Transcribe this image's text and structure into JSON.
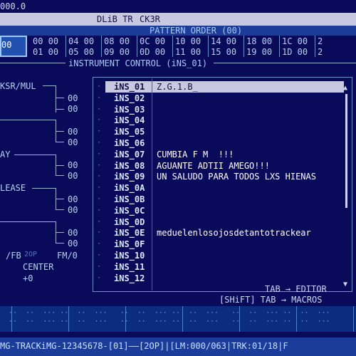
{
  "topbar": {
    "left_value": "000.0",
    "title": "DLiB TR",
    "mid": "CK3R"
  },
  "pattern_order": {
    "title": "PATTERN ORDER (00)",
    "current": "00",
    "row1": [
      "00",
      "04",
      "08",
      "0C",
      "10",
      "14",
      "18",
      "1C",
      "2"
    ],
    "row1b": [
      "00",
      "00",
      "00",
      "00",
      "00",
      "00",
      "00",
      "00"
    ],
    "row2": [
      "01",
      "05",
      "09",
      "0D",
      "11",
      "15",
      "19",
      "1D",
      "2"
    ],
    "row2b": [
      "00",
      "00",
      "00",
      "00",
      "00",
      "00",
      "00",
      "00"
    ]
  },
  "instrument_control": {
    "title": "iNSTRUMENT CONTROL (iNS_01)",
    "left": {
      "ksr_mul": "KSR/MUL",
      "v1": "00",
      "v2": "00",
      "v3": "00",
      "v4": "00",
      "v5": "00",
      "v6": "00",
      "v7": "00",
      "v8": "00",
      "ay": "AY",
      "lease": "LEASE",
      "fb": "/FB",
      "fb2": "2OP",
      "fm": "FM/0",
      "center": "CENTER",
      "plus0": "+0"
    },
    "instruments": [
      {
        "label": "iNS_01",
        "name": "Z.G.1.B_"
      },
      {
        "label": "iNS_02",
        "name": ""
      },
      {
        "label": "iNS_03",
        "name": ""
      },
      {
        "label": "iNS_04",
        "name": ""
      },
      {
        "label": "iNS_05",
        "name": ""
      },
      {
        "label": "iNS_06",
        "name": ""
      },
      {
        "label": "iNS_07",
        "name": "CUMBIA F M  !!!"
      },
      {
        "label": "iNS_08",
        "name": "AGUANTE ADTII AMEGO!!!"
      },
      {
        "label": "iNS_09",
        "name": "UN SALUDO PARA TODOS LXS HIENAS"
      },
      {
        "label": "iNS_0A",
        "name": ""
      },
      {
        "label": "iNS_0B",
        "name": ""
      },
      {
        "label": "iNS_0C",
        "name": ""
      },
      {
        "label": "iNS_0D",
        "name": ""
      },
      {
        "label": "iNS_0E",
        "name": "meduelenlosojosdetantotrackear"
      },
      {
        "label": "iNS_0F",
        "name": ""
      },
      {
        "label": "iNS_10",
        "name": ""
      },
      {
        "label": "iNS_11",
        "name": ""
      },
      {
        "label": "iNS_12",
        "name": ""
      }
    ],
    "hint1": "TAB → EDITOR",
    "hint2": "[SHiFT] TAB → MACROS"
  },
  "status": {
    "text": "MG-TRACKiMG-12345678-[01]——[2OP]|[LM:000/063|TRK:01/18|F"
  },
  "colors": {
    "bg": "#0a0a5a",
    "highlight": "#c8c8e0",
    "accent": "#1c3c9a"
  }
}
